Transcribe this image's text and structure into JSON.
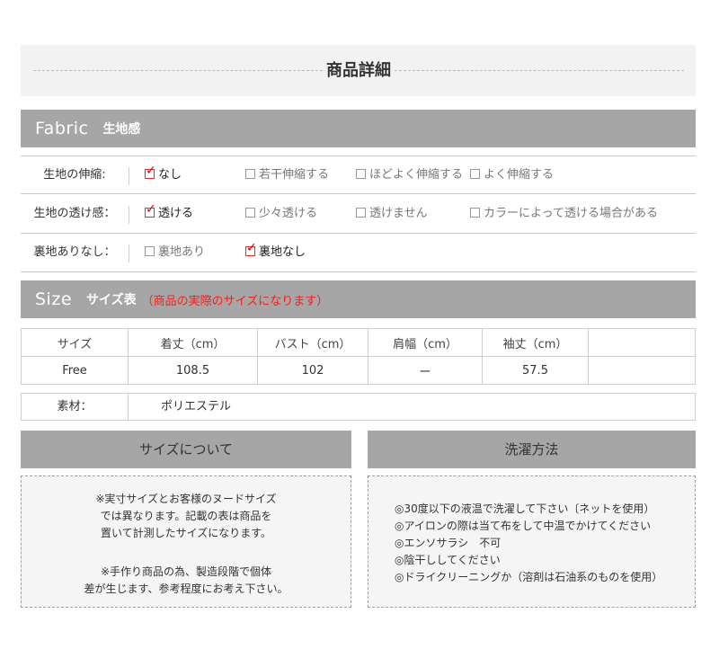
{
  "header": {
    "title": "商品詳細"
  },
  "fabric": {
    "title_en": "Fabric",
    "title_jp": "生地感",
    "rows": [
      {
        "label": "生地の伸縮:",
        "options": [
          {
            "text": "なし",
            "checked": true
          },
          {
            "text": "若干伸縮する",
            "checked": false
          },
          {
            "text": "ほどよく伸縮する",
            "checked": false
          },
          {
            "text": "よく伸縮する",
            "checked": false
          }
        ]
      },
      {
        "label": "生地の透け感：",
        "options": [
          {
            "text": "透ける",
            "checked": true
          },
          {
            "text": "少々透ける",
            "checked": false
          },
          {
            "text": "透けません",
            "checked": false
          },
          {
            "text": "カラーによって透ける場合がある",
            "checked": false
          }
        ]
      },
      {
        "label": "裏地ありなし：",
        "options": [
          {
            "text": "裏地あり",
            "checked": false
          },
          {
            "text": "裏地なし",
            "checked": true
          }
        ]
      }
    ]
  },
  "size": {
    "title_en": "Size",
    "title_jp": "サイズ表",
    "note": "（商品の実際のサイズになります）",
    "headers": [
      "サイズ",
      "着丈（cm）",
      "バスト（cm）",
      "肩幅（cm）",
      "袖丈（cm）",
      ""
    ],
    "rows": [
      [
        "Free",
        "108.5",
        "102",
        "ー",
        "57.5",
        ""
      ]
    ]
  },
  "material": {
    "label": "素材：",
    "value": "ポリエステル"
  },
  "about_size": {
    "title": "サイズについて",
    "para1": [
      "※実寸サイズとお客様のヌードサイズ",
      "では異なります。記載の表は商品を",
      "置いて計測したサイズになります。"
    ],
    "para2": [
      "※手作り商品の為、製造段階で個体",
      "差が生じます、参考程度にお考え下さい。"
    ]
  },
  "washing": {
    "title": "洗濯方法",
    "items": [
      "◎30度以下の液温で洗濯して下さい〔ネットを使用）",
      "◎アイロンの際は当て布をして中温でかけてください",
      "◎エンソサラシ　不可",
      "◎陰干ししてください",
      "◎ドライクリーニングか（溶剤は石油系のものを使用）"
    ]
  }
}
